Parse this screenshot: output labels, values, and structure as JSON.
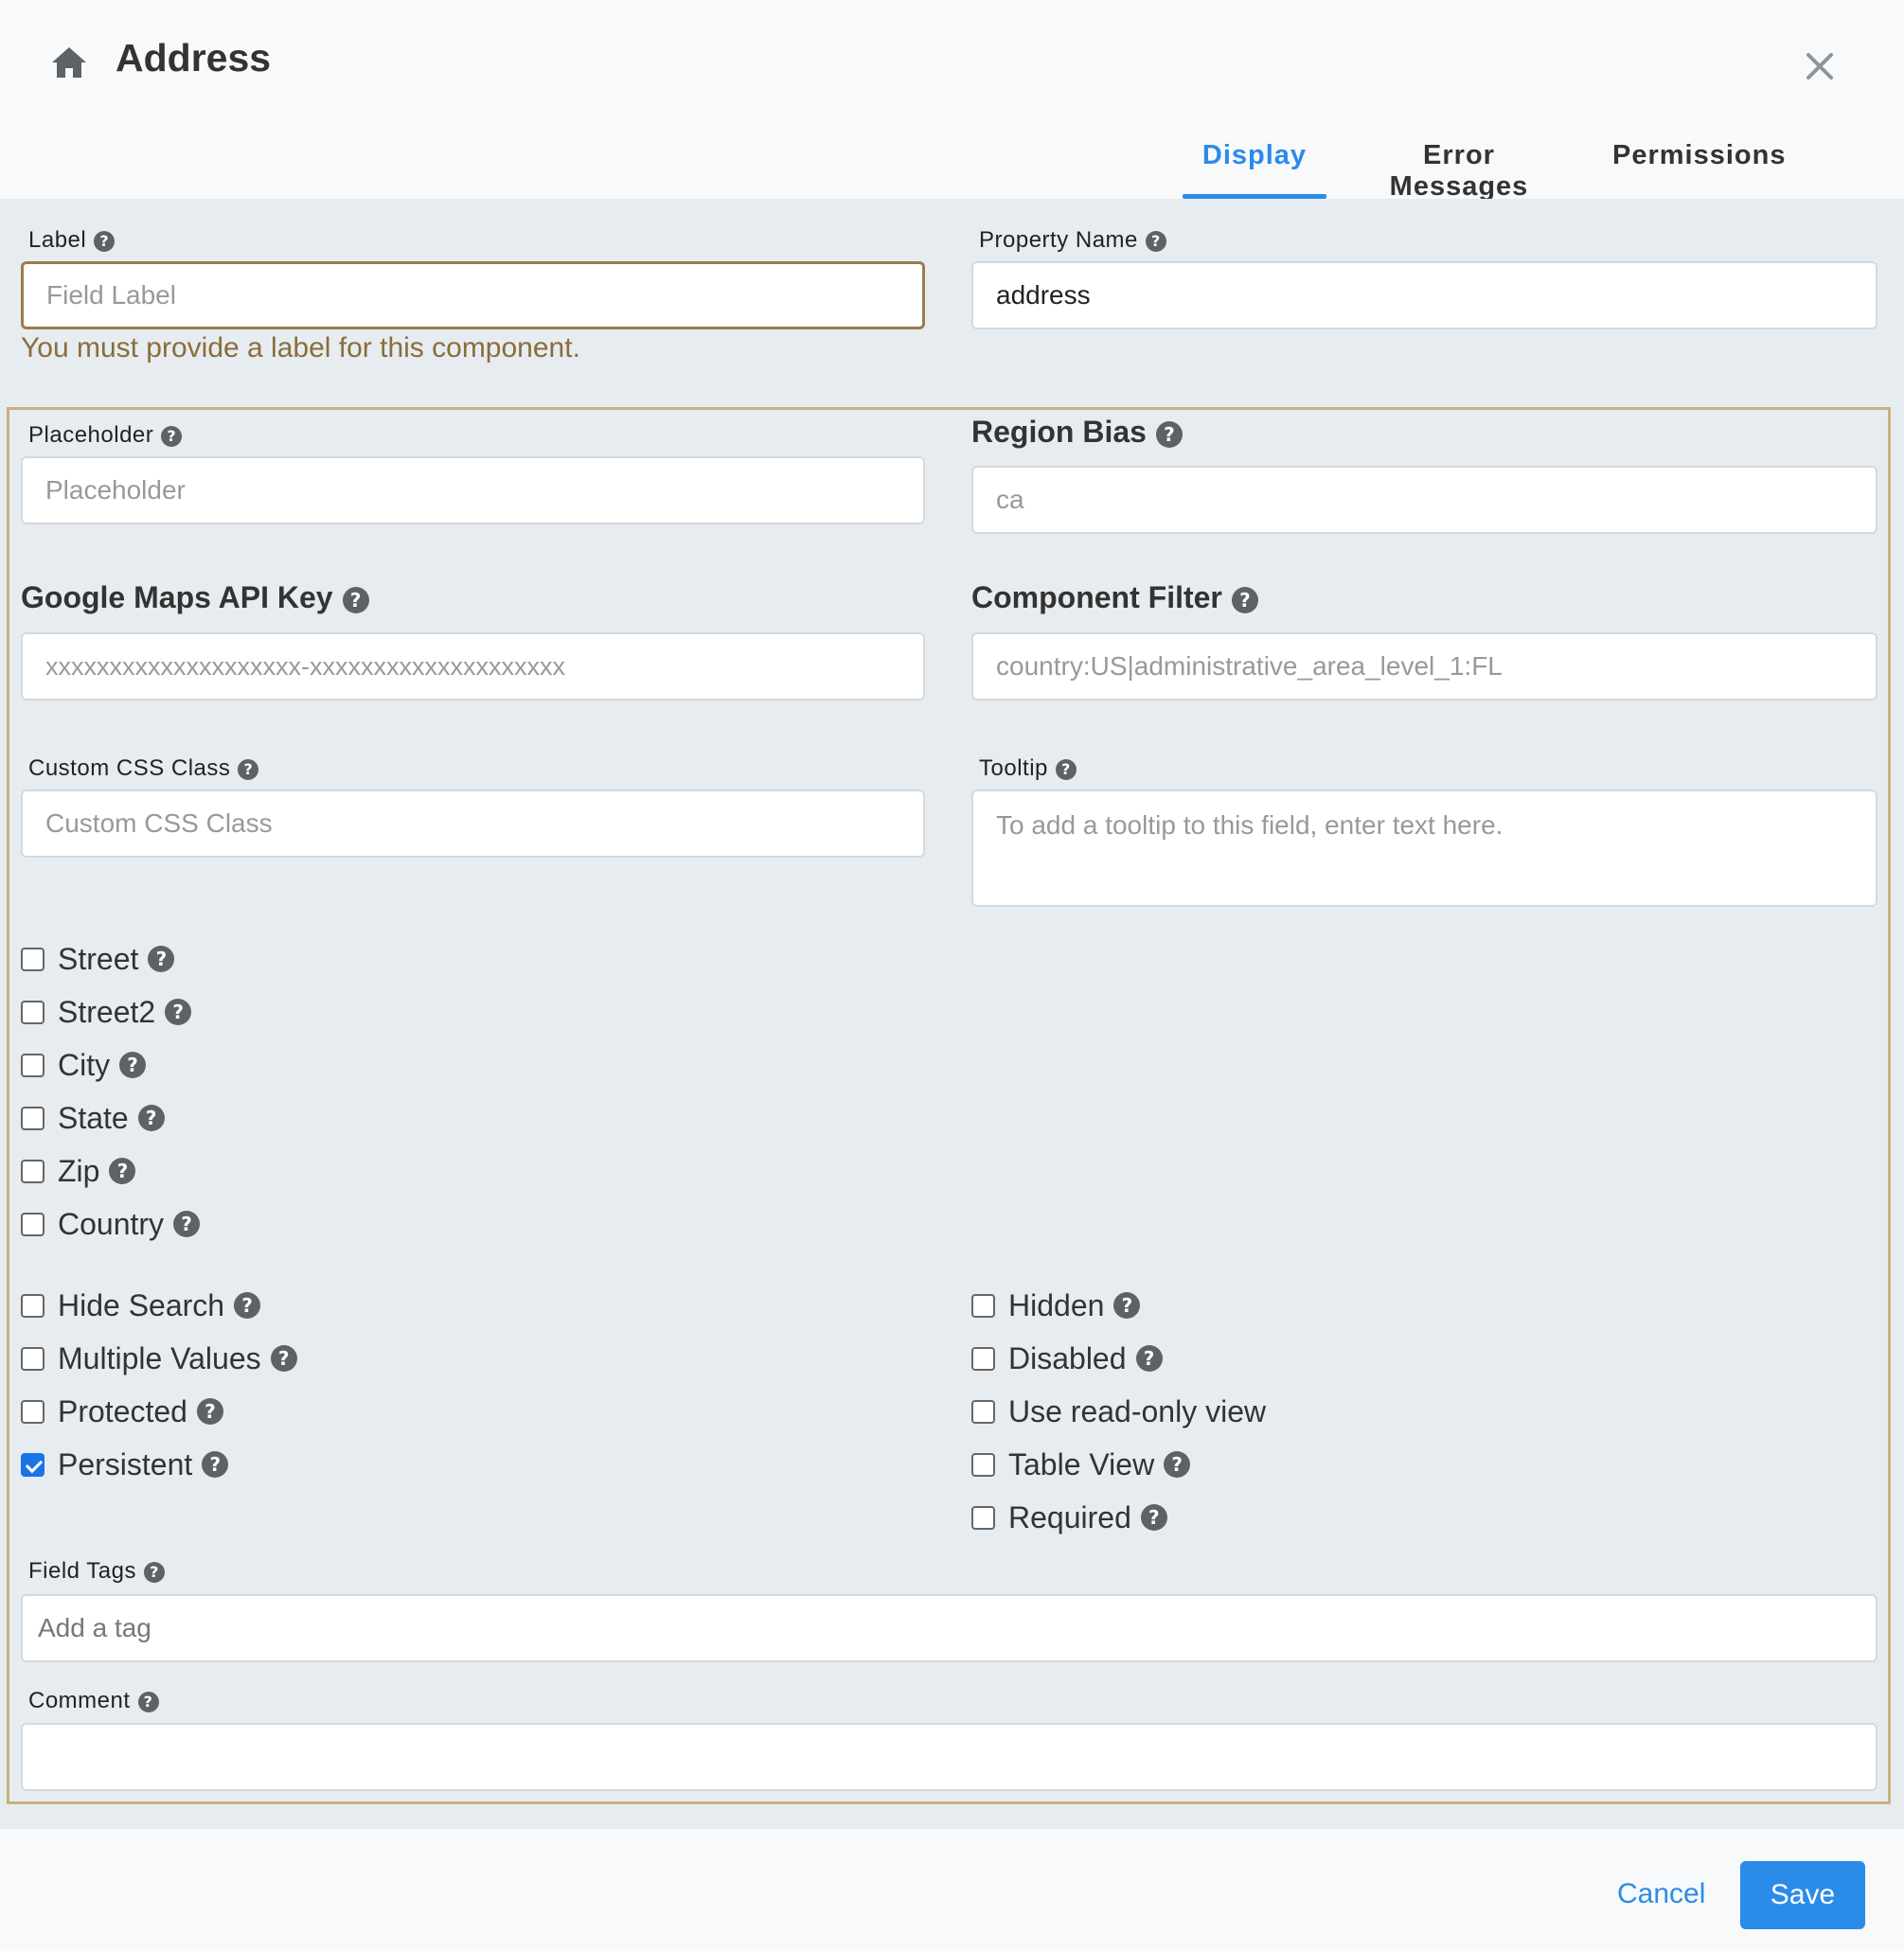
{
  "header": {
    "icon": "home-icon",
    "title": "Address",
    "close_icon": "close-icon",
    "tabs": [
      {
        "label": "Display",
        "active": true
      },
      {
        "label": "Error Messages",
        "active": false
      },
      {
        "label": "Permissions",
        "active": false
      }
    ]
  },
  "fields": {
    "label": {
      "label": "Label",
      "value": "",
      "placeholder": "Field Label",
      "error": "You must provide a label for this component."
    },
    "property_name": {
      "label": "Property Name",
      "value": "address"
    },
    "placeholder": {
      "label": "Placeholder",
      "value": "",
      "placeholder": "Placeholder"
    },
    "region_bias": {
      "label": "Region Bias",
      "value": "",
      "placeholder": "ca"
    },
    "api_key": {
      "label": "Google Maps API Key",
      "value": "",
      "placeholder": "xxxxxxxxxxxxxxxxxxxx-xxxxxxxxxxxxxxxxxxxx"
    },
    "component_filter": {
      "label": "Component Filter",
      "value": "",
      "placeholder": "country:US|administrative_area_level_1:FL"
    },
    "custom_css": {
      "label": "Custom CSS Class",
      "value": "",
      "placeholder": "Custom CSS Class"
    },
    "tooltip": {
      "label": "Tooltip",
      "value": "",
      "placeholder": "To add a tooltip to this field, enter text here."
    },
    "field_tags": {
      "label": "Field Tags",
      "value": "",
      "placeholder": "Add a tag"
    },
    "comment": {
      "label": "Comment",
      "value": "",
      "placeholder": ""
    }
  },
  "address_parts": [
    {
      "label": "Street",
      "checked": false
    },
    {
      "label": "Street2",
      "checked": false
    },
    {
      "label": "City",
      "checked": false
    },
    {
      "label": "State",
      "checked": false
    },
    {
      "label": "Zip",
      "checked": false
    },
    {
      "label": "Country",
      "checked": false
    }
  ],
  "options_left": [
    {
      "label": "Hide Search",
      "checked": false,
      "help": true
    },
    {
      "label": "Multiple Values",
      "checked": false,
      "help": true
    },
    {
      "label": "Protected",
      "checked": false,
      "help": true
    },
    {
      "label": "Persistent",
      "checked": true,
      "help": true
    }
  ],
  "options_right": [
    {
      "label": "Hidden",
      "checked": false,
      "help": true
    },
    {
      "label": "Disabled",
      "checked": false,
      "help": true
    },
    {
      "label": "Use read-only view",
      "checked": false,
      "help": false
    },
    {
      "label": "Table View",
      "checked": false,
      "help": true
    },
    {
      "label": "Required",
      "checked": false,
      "help": true
    }
  ],
  "footer": {
    "cancel_label": "Cancel",
    "save_label": "Save"
  },
  "colors": {
    "accent": "#2b8be8",
    "error": "#8a6d3b",
    "checked": "#1a73e8"
  }
}
